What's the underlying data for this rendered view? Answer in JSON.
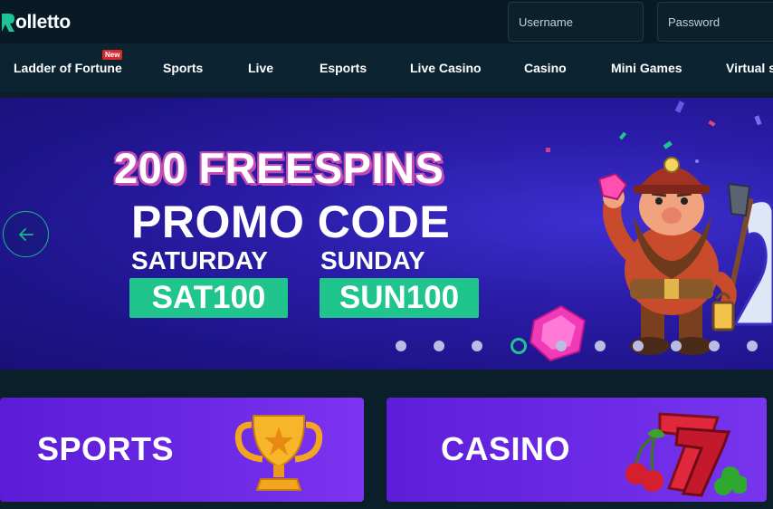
{
  "brand": {
    "name": "olletto",
    "mark": "R"
  },
  "login": {
    "username_placeholder": "Username",
    "password_placeholder": "Password"
  },
  "nav": {
    "items": [
      {
        "label": "Ladder of Fortune",
        "badge": "New"
      },
      {
        "label": "Sports"
      },
      {
        "label": "Live"
      },
      {
        "label": "Esports"
      },
      {
        "label": "Live Casino"
      },
      {
        "label": "Casino"
      },
      {
        "label": "Mini Games"
      },
      {
        "label": "Virtual s"
      }
    ]
  },
  "banner": {
    "headline": "200 FREESPINS",
    "subheadline": "PROMO CODE",
    "saturday_label": "SATURDAY",
    "saturday_code": "SAT100",
    "sunday_label": "SUNDAY",
    "sunday_code": "SUN100",
    "slide_count": 10,
    "active_slide": 4
  },
  "cards": {
    "sports_label": "SPORTS",
    "casino_label": "CASINO"
  },
  "colors": {
    "accent": "#1ec494",
    "background": "#0b1f2b",
    "banner": "#2a1ca6",
    "badge": "#d72b2b",
    "card": "#6a28e3"
  }
}
